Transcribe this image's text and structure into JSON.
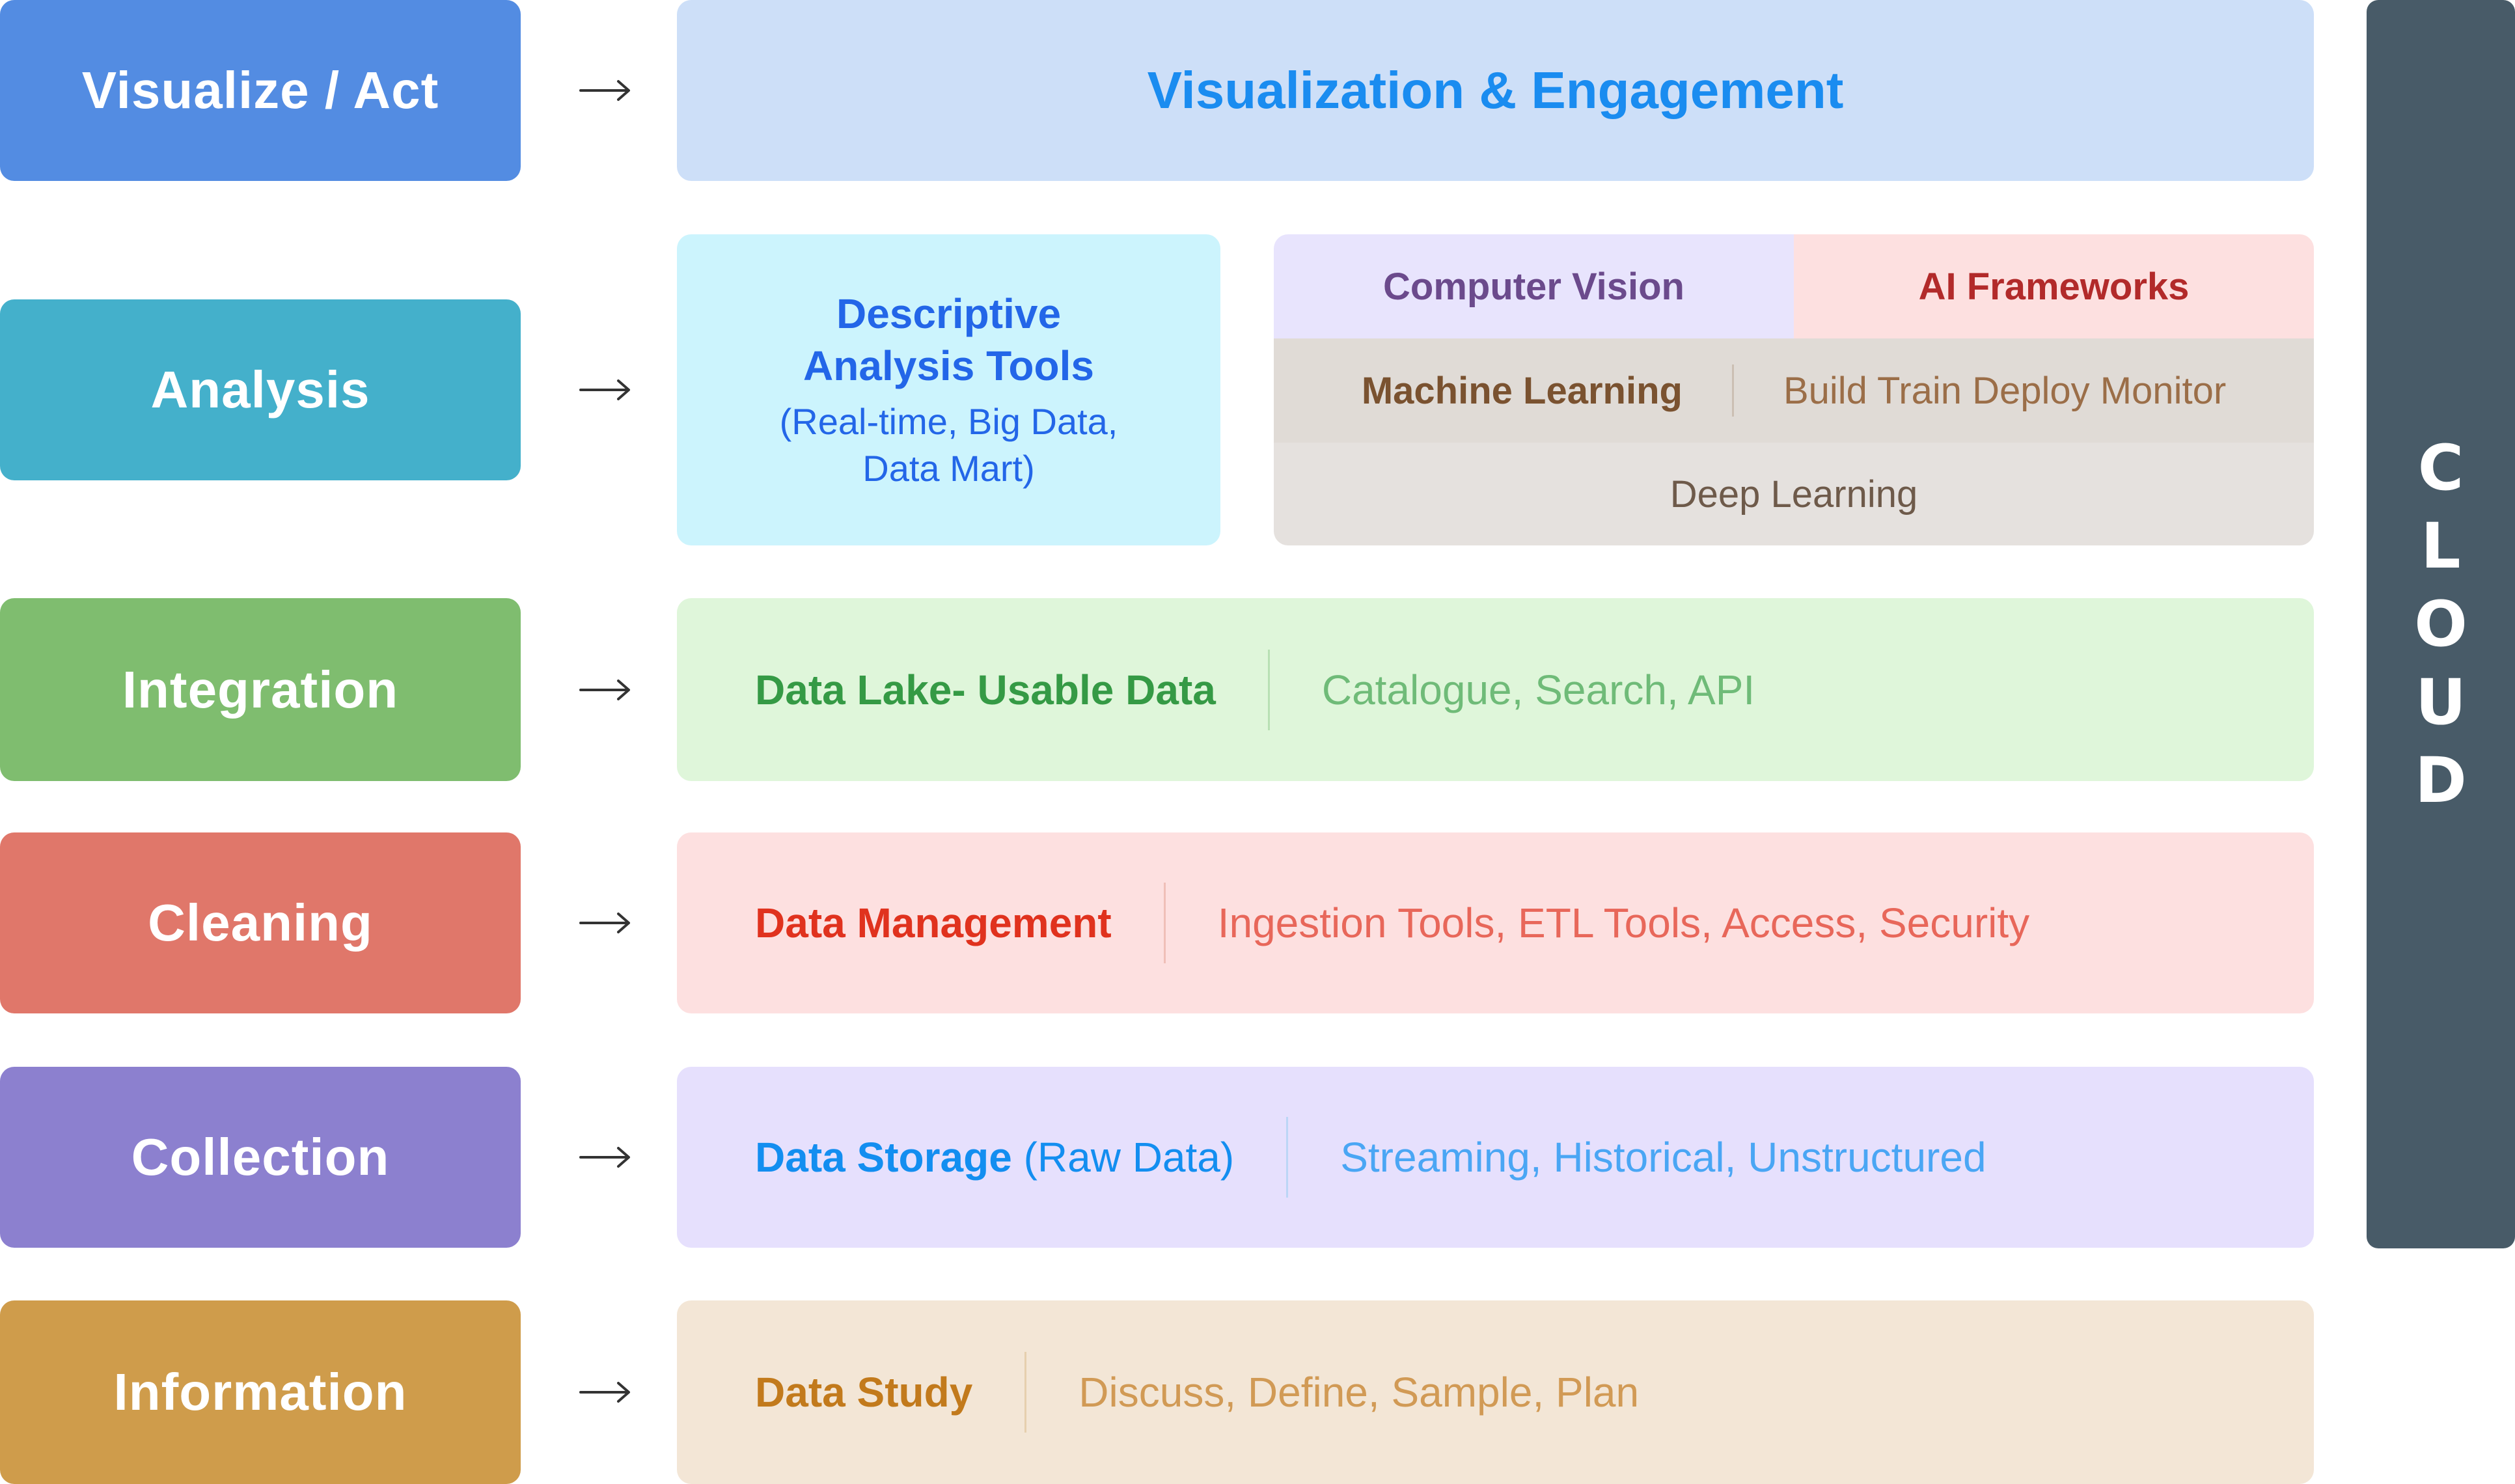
{
  "stages": [
    {
      "label": "Visualize / Act",
      "color": "#538ce2"
    },
    {
      "label": "Analysis",
      "color": "#44b0cb"
    },
    {
      "label": "Integration",
      "color": "#7fbd6f"
    },
    {
      "label": "Cleaning",
      "color": "#e0776a"
    },
    {
      "label": "Collection",
      "color": "#8c80cf"
    },
    {
      "label": "Information",
      "color": "#cf9c4b"
    }
  ],
  "arrow_icon": "right-arrow",
  "visualization": {
    "title": "Visualization & Engagement",
    "bg": "#cddff8",
    "color": "#1a8cf0"
  },
  "analysis": {
    "descriptive": {
      "title_line1": "Descriptive",
      "title_line2": "Analysis Tools",
      "sub_line1": "(Real-time, Big Data,",
      "sub_line2": "Data Mart)"
    },
    "ai_block": {
      "computer_vision": "Computer Vision",
      "ai_frameworks": "AI Frameworks",
      "machine_learning": "Machine Learning",
      "ml_steps": "Build Train Deploy Monitor",
      "deep_learning": "Deep Learning"
    }
  },
  "integration": {
    "primary": "Data Lake- Usable Data",
    "secondary": "Catalogue, Search, API",
    "bg": "#dff6da",
    "primary_color": "#359a45",
    "secondary_color": "#6fbb78",
    "divider_color": "#b8e0b4"
  },
  "cleaning": {
    "primary": "Data Management",
    "secondary": "Ingestion Tools, ETL Tools, Access, Security",
    "bg": "#fde0e0",
    "primary_color": "#e0321e",
    "secondary_color": "#e8675a",
    "divider_color": "#f0bfb8"
  },
  "collection": {
    "primary": "Data Storage",
    "primary_muted": " (Raw Data)",
    "secondary": "Streaming, Historical, Unstructured",
    "bg": "#e6e0fd",
    "primary_color": "#138ef0",
    "secondary_color": "#4aa6f4",
    "divider_color": "#bcd6f6"
  },
  "information": {
    "primary": "Data Study",
    "secondary": "Discuss, Define, Sample, Plan",
    "bg": "#f3e6d6",
    "primary_color": "#c27a1c",
    "secondary_color": "#d19a55",
    "divider_color": "#e6cfae"
  },
  "cloud": {
    "letters": [
      "C",
      "L",
      "O",
      "U",
      "D"
    ],
    "bg": "#485b68"
  }
}
